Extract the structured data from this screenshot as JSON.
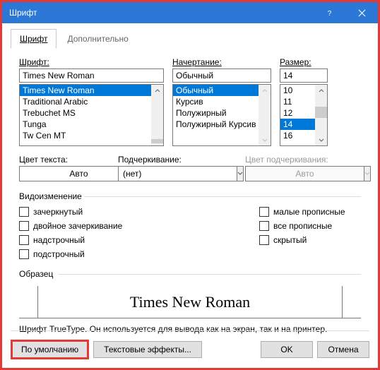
{
  "window": {
    "title": "Шрифт"
  },
  "tabs": {
    "font": "Шрифт",
    "advanced": "Дополнительно"
  },
  "labels": {
    "font": "Шрифт:",
    "font_u": "Ш",
    "style": "Начертание:",
    "style_u": "Н",
    "size": "Размер:",
    "size_u": "Р",
    "color": "Цвет текста:",
    "underline": "Подчеркивание:",
    "ucolor": "Цвет подчеркивания:",
    "effects": "Видоизменение",
    "sample": "Образец"
  },
  "font": {
    "value": "Times New Roman",
    "items": [
      "Times New Roman",
      "Traditional Arabic",
      "Trebuchet MS",
      "Tunga",
      "Tw Cen MT"
    ]
  },
  "style": {
    "value": "Обычный",
    "items": [
      "Обычный",
      "Курсив",
      "Полужирный",
      "Полужирный Курсив"
    ]
  },
  "size": {
    "value": "14",
    "items": [
      "10",
      "11",
      "12",
      "14",
      "16"
    ]
  },
  "color": {
    "value": "Авто"
  },
  "underline": {
    "value": "(нет)"
  },
  "ucolor": {
    "value": "Авто"
  },
  "effects": {
    "strike": "зачеркнутый",
    "dstrike": "двойное зачеркивание",
    "super": "надстрочный",
    "sub": "подстрочный",
    "smallcaps": "малые прописные",
    "allcaps": "все прописные",
    "hidden": "скрытый"
  },
  "sample": {
    "text": "Times New Roman"
  },
  "hint": "Шрифт TrueType. Он используется для вывода как на экран, так и на принтер.",
  "buttons": {
    "default": "По умолчанию",
    "texteffects": "Текстовые эффекты...",
    "ok": "OK",
    "cancel": "Отмена"
  }
}
